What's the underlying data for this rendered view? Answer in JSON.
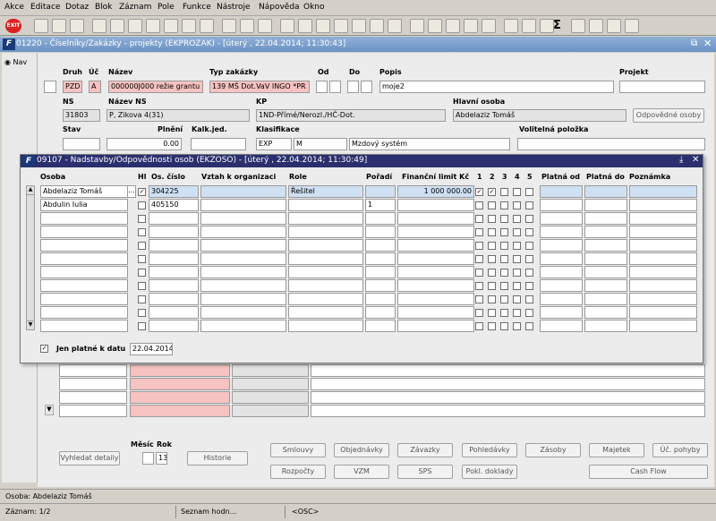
{
  "menu": [
    "Akce",
    "Editace",
    "Dotaz",
    "Blok",
    "Záznam",
    "Pole",
    "Funkce",
    "Nástroje",
    "Nápověda",
    "Okno"
  ],
  "toolbar": {
    "exit_label": "EXIT"
  },
  "main_window": {
    "title": "01220 - Číselníky/Zakázky - projekty (EKPROZAK) - [úterý , 22.04.2014; 11:30:43]"
  },
  "nav": {
    "label": "Nav"
  },
  "form": {
    "labels": {
      "druh": "Druh",
      "uc": "Úč",
      "nazev": "Název",
      "typ_zakazky": "Typ zakázky",
      "od": "Od",
      "do": "Do",
      "popis": "Popis",
      "projekt": "Projekt",
      "ns": "NS",
      "nazev_ns": "Název NS",
      "kp": "KP",
      "hlavni_osoba": "Hlavní osoba",
      "stav": "Stav",
      "plneni": "Plnění",
      "kalk_jed": "Kalk.jed.",
      "klasifikace": "Klasifikace",
      "volitelna_polozka": "Volitelná položka",
      "mesic": "Měsíc",
      "rok": "Rok"
    },
    "values": {
      "druh": "PZD",
      "uc": "A",
      "nazev": "000000J000 režie grantu II",
      "typ_zakazky": "139 MŠ Dot.VaV INGO *PR",
      "popis": "moje2",
      "ns": "31803",
      "nazev_ns": "P, Zikova 4(31)",
      "kp": "1ND-Přímé/Nerozl./HČ-Dot.",
      "hlavni_osoba": "Abdelaziz Tomáš",
      "plneni": "0.00",
      "klasifikace_code": "EXP",
      "klasifikace_m": "M",
      "klasifikace_desc": "Mzdový systém",
      "rok": "13"
    },
    "buttons": {
      "odpovedne_osoby": "Odpovědné osoby",
      "vyhledat_detaily": "Vyhledat detaily",
      "historie": "Historie",
      "smlouvy": "Smlouvy",
      "objednavky": "Objednávky",
      "zavazky": "Závazky",
      "pohledavky": "Pohledávky",
      "zasoby": "Zásoby",
      "majetek": "Majetek",
      "uc_pohyby": "Úč. pohyby",
      "rozpocty": "Rozpočty",
      "vzm": "VZM",
      "sps": "SPS",
      "pokl_doklady": "Pokl. doklady",
      "cash_flow": "Cash Flow"
    }
  },
  "dialog": {
    "title": "09107 - Nadstavby/Odpovědnosti osob (EKZOSO) - [úterý , 22.04.2014; 11:30:49]",
    "columns": {
      "osoba": "Osoba",
      "hl": "Hl",
      "os_cislo": "Os. číslo",
      "vztah": "Vztah k organizaci",
      "role": "Role",
      "poradi": "Pořadí",
      "limit": "Finanční limit Kč",
      "c1": "1",
      "c2": "2",
      "c3": "3",
      "c4": "4",
      "c5": "5",
      "platna_od": "Platná od",
      "platna_do": "Platná do",
      "poznamka": "Poznámka"
    },
    "rows": [
      {
        "osoba": "Abdelaziz Tomáš",
        "hl": "✓",
        "os_cislo": "304225",
        "vztah": "",
        "role": "Řešitel",
        "poradi": "",
        "limit": "1 000 000.00",
        "c1": "✓",
        "c2": "✓",
        "c3": "",
        "c4": "",
        "c5": "",
        "platna_od": "",
        "platna_do": "",
        "poznamka": ""
      },
      {
        "osoba": "Abdulin Iulia",
        "hl": "",
        "os_cislo": "405150",
        "vztah": "",
        "role": "",
        "poradi": "1",
        "limit": "",
        "c1": "",
        "c2": "",
        "c3": "",
        "c4": "",
        "c5": "",
        "platna_od": "",
        "platna_do": "",
        "poznamka": ""
      }
    ],
    "filter_label": "Jen platné k datu",
    "filter_checked": "✓",
    "filter_date": "22.04.2014",
    "ellipsis": "..."
  },
  "status": {
    "line1": "Osoba: Abdelaziz Tomáš",
    "record": "Záznam: 1/2",
    "list": "Seznam hodn...",
    "osc": "<OSC>"
  }
}
